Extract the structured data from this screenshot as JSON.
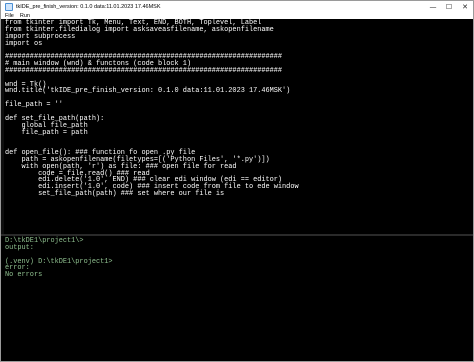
{
  "window": {
    "title": "tkIDE_pre_finish_version: 0.1.0 data:11.01.2023 17.46MSK",
    "controls": {
      "minimize": "—",
      "maximize": "☐",
      "close": "✕"
    }
  },
  "menubar": {
    "items": [
      "File",
      "Run"
    ]
  },
  "editor": {
    "code": "from tkinter import Tk, Menu, Text, END, BOTH, Toplevel, Label\nfrom tkinter.filedialog import asksaveasfilename, askopenfilename\nimport subprocess\nimport os\n\n###################################################################\n# main window (wnd) & functons (code block 1)\n###################################################################\n\nwnd = Tk()\nwnd.title('tkIDE_pre_finish_version: 0.1.0 data:11.01.2023 17.46MSK')\n\nfile_path = ''\n\ndef set_file_path(path):\n    global file_path\n    file_path = path\n\n\ndef open_file(): ### function fo open .py file\n    path = askopenfilename(filetypes=[('Python Files', '*.py')])\n    with open(path, 'r') as file: ### open file for read\n        code = file.read() ### read\n        edi.delete('1.0', END) ### clear edi window (edi == editor)\n        edi.insert('1.0', code) ### insert code from file to ede window\n        set_file_path(path) ### set where our file is"
  },
  "console": {
    "lines": [
      "D:\\tkDE1\\project1\\>",
      "output:",
      "",
      "(.venv) D:\\tkDE1\\project1>",
      "error:",
      "No errors"
    ]
  }
}
